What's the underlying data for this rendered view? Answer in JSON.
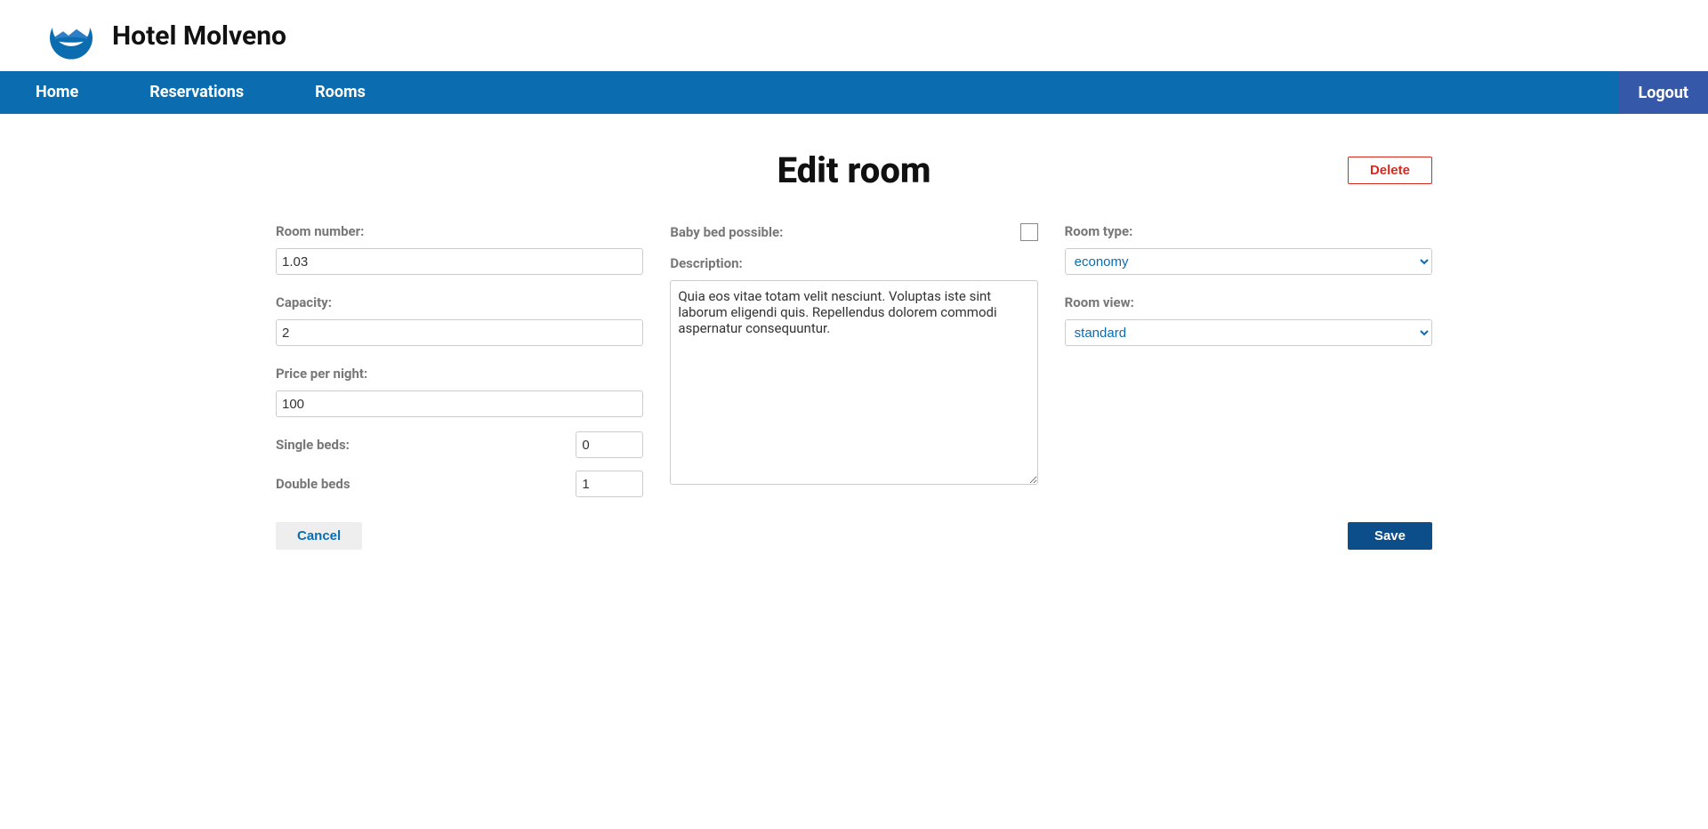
{
  "brand": {
    "title": "Hotel Molveno"
  },
  "nav": {
    "home": "Home",
    "reservations": "Reservations",
    "rooms": "Rooms",
    "logout": "Logout"
  },
  "page": {
    "title": "Edit room",
    "delete": "Delete",
    "cancel": "Cancel",
    "save": "Save"
  },
  "form": {
    "room_number": {
      "label": "Room number:",
      "value": "1.03"
    },
    "capacity": {
      "label": "Capacity:",
      "value": "2"
    },
    "price": {
      "label": "Price per night:",
      "value": "100"
    },
    "single_beds": {
      "label": "Single beds:",
      "value": "0"
    },
    "double_beds": {
      "label": "Double beds",
      "value": "1"
    },
    "baby_bed": {
      "label": "Baby bed possible:"
    },
    "description": {
      "label": "Description:",
      "value": "Quia eos vitae totam velit nesciunt. Voluptas iste sint laborum eligendi quis. Repellendus dolorem commodi aspernatur consequuntur."
    },
    "room_type": {
      "label": "Room type:",
      "selected": "economy"
    },
    "room_view": {
      "label": "Room view:",
      "selected": "standard"
    }
  }
}
